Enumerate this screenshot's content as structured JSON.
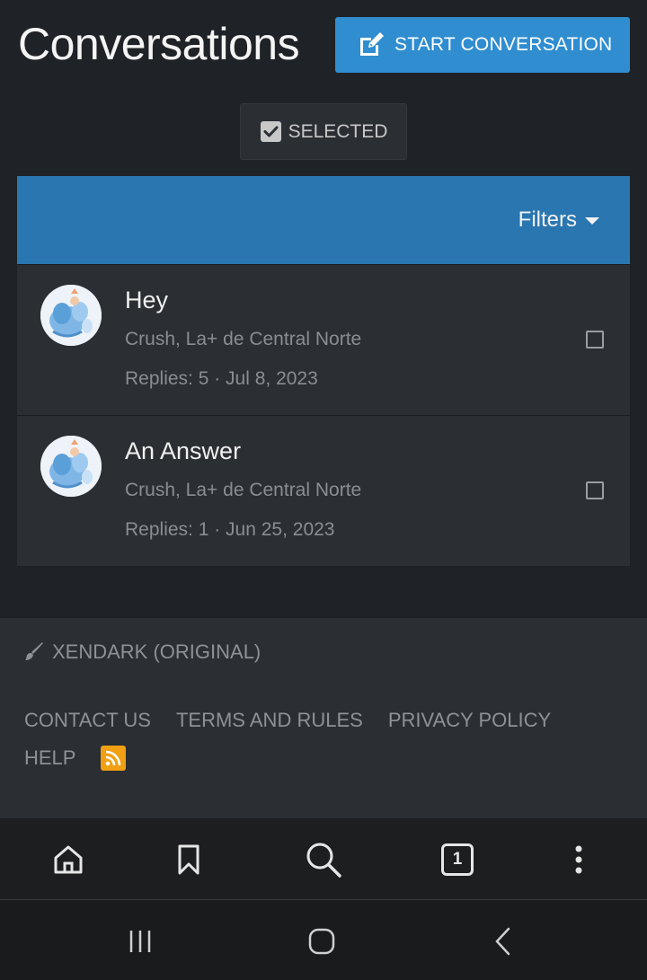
{
  "header": {
    "title": "Conversations",
    "start_button": "START CONVERSATION"
  },
  "toolbar": {
    "selected_button": "SELECTED"
  },
  "filter_bar": {
    "filters_label": "Filters"
  },
  "conversations": [
    {
      "title": "Hey",
      "participants": "Crush, La+ de Central Norte",
      "meta": "Replies: 5 · Jul 8, 2023"
    },
    {
      "title": "An Answer",
      "participants": "Crush, La+ de Central Norte",
      "meta": "Replies: 1 · Jun 25, 2023"
    }
  ],
  "footer": {
    "style_chooser": "XENDARK (ORIGINAL)",
    "links": [
      "CONTACT US",
      "TERMS AND RULES",
      "PRIVACY POLICY",
      "HELP"
    ]
  },
  "browser_bar": {
    "tab_count": "1"
  },
  "colors": {
    "accent": "#2f8dd0",
    "filter_bar": "#2a76b0",
    "background": "#1f2226",
    "panel": "#2b2e33",
    "rss": "#f0a012"
  }
}
